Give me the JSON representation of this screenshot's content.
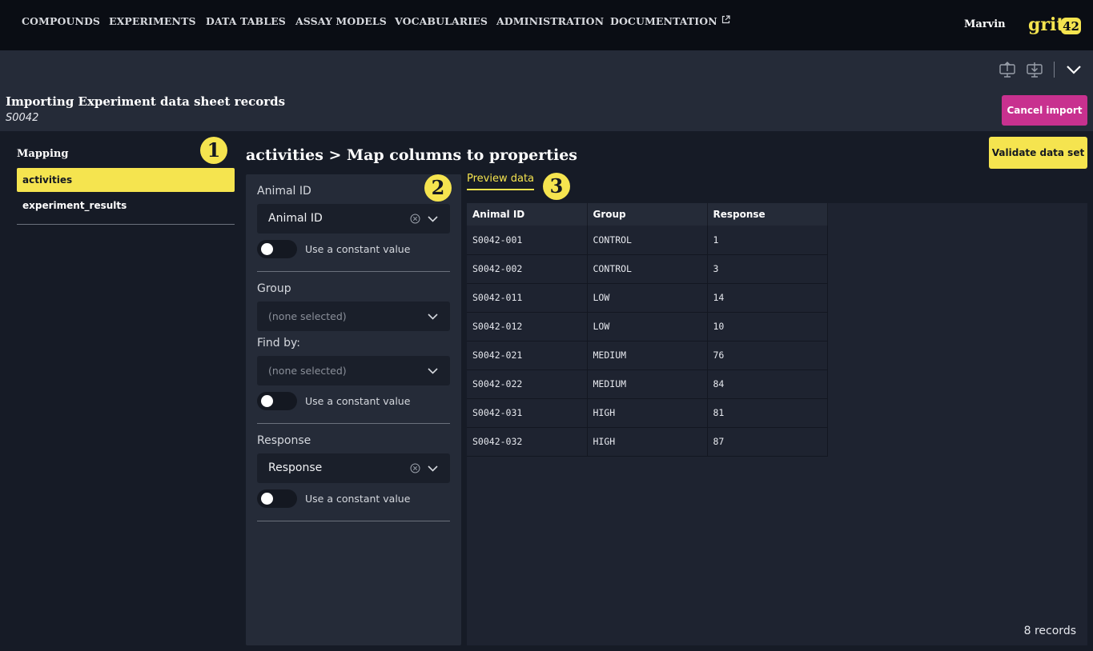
{
  "nav": {
    "items": [
      "COMPOUNDS",
      "EXPERIMENTS",
      "DATA TABLES",
      "ASSAY MODELS",
      "VOCABULARIES",
      "ADMINISTRATION",
      "DOCUMENTATION"
    ],
    "user": "Marvin",
    "logo_text": "grit",
    "logo_num": "42",
    "external_icon": "external-link-icon"
  },
  "toolbar": {
    "icons": [
      "upload-icon",
      "download-icon",
      "chevron-down-icon"
    ]
  },
  "header": {
    "title": "Importing Experiment data sheet records",
    "subtitle": "S0042",
    "cancel_label": "Cancel import"
  },
  "sidebar": {
    "title": "Mapping",
    "items": [
      {
        "label": "activities",
        "active": true
      },
      {
        "label": "experiment_results",
        "active": false
      }
    ]
  },
  "badges": [
    "1",
    "2",
    "3"
  ],
  "main": {
    "title": "activities > Map columns to properties",
    "validate_label": "Validate data set"
  },
  "mapping": {
    "fields": [
      {
        "label": "Animal ID",
        "value": "Animal ID",
        "toggle_label": "Use a constant value"
      },
      {
        "label": "Group",
        "value": "(none selected)",
        "find_by_label": "Find by:",
        "find_by_value": "(none selected)",
        "toggle_label": "Use a constant value"
      },
      {
        "label": "Response",
        "value": "Response",
        "toggle_label": "Use a constant value"
      }
    ]
  },
  "preview": {
    "tab_label": "Preview data",
    "columns": [
      "Animal ID",
      "Group",
      "Response"
    ],
    "rows": [
      [
        "S0042-001",
        "CONTROL",
        "1"
      ],
      [
        "S0042-002",
        "CONTROL",
        "3"
      ],
      [
        "S0042-011",
        "LOW",
        "14"
      ],
      [
        "S0042-012",
        "LOW",
        "10"
      ],
      [
        "S0042-021",
        "MEDIUM",
        "76"
      ],
      [
        "S0042-022",
        "MEDIUM",
        "84"
      ],
      [
        "S0042-031",
        "HIGH",
        "81"
      ],
      [
        "S0042-032",
        "HIGH",
        "87"
      ]
    ],
    "record_count": "8 records"
  },
  "colors": {
    "accent": "#f5e44f",
    "danger": "#c8318f",
    "background": "#161b26",
    "panel": "#252b38"
  }
}
